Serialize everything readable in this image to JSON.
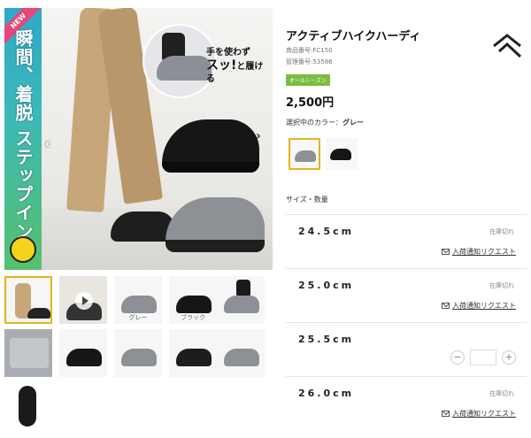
{
  "gallery": {
    "banner_new": "NEW",
    "banner_text": "瞬間、着脱 ステップイン",
    "catch_line1": "手を使わず",
    "catch_big": "スッ!",
    "catch_line2": "と履ける",
    "prev_arrow": "‹",
    "next_arrow": "›",
    "thumbnails": [
      {
        "caption": ""
      },
      {
        "caption": ""
      },
      {
        "caption": "グレー"
      },
      {
        "caption": "ブラック"
      },
      {
        "caption": ""
      },
      {
        "caption": ""
      },
      {
        "caption": ""
      },
      {
        "caption": ""
      },
      {
        "caption": ""
      },
      {
        "caption": ""
      },
      {
        "caption": ""
      }
    ]
  },
  "product": {
    "title": "アクティブハイクハーディ",
    "product_number": "商品番号:FC150",
    "management_number": "管理番号:53586",
    "season_badge": "オールシーズン",
    "price": "2,500円",
    "color_label": "選択中のカラー：",
    "color_value": "グレー",
    "size_label": "サイズ・数量"
  },
  "sizes": [
    {
      "size": "24.5cm",
      "stock": "在庫切れ",
      "notify": "入荷通知リクエスト"
    },
    {
      "size": "25.0cm",
      "stock": "在庫切れ",
      "notify": "入荷通知リクエスト"
    },
    {
      "size": "25.5cm",
      "minus": "−",
      "plus": "+"
    },
    {
      "size": "26.0cm",
      "stock": "在庫切れ",
      "notify": "入荷通知リクエスト"
    }
  ],
  "colors": {
    "accent": "#e4b51c",
    "badge_green": "#7bbd3f",
    "grey_shoe": "#8d9196",
    "black_shoe": "#161616"
  }
}
